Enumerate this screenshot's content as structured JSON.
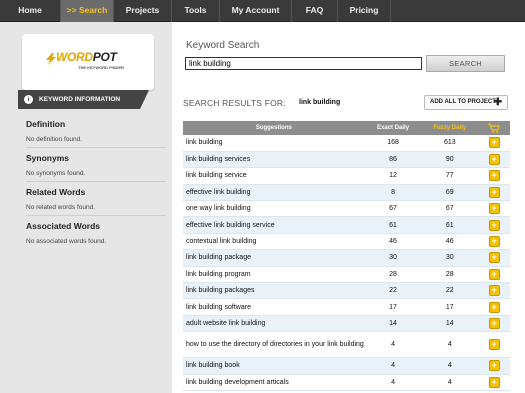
{
  "nav": {
    "items": [
      {
        "label": "Home",
        "active": false
      },
      {
        "label": ">> Search",
        "active": true
      },
      {
        "label": "Projects",
        "active": false
      },
      {
        "label": "Tools",
        "active": false
      },
      {
        "label": "My Account",
        "active": false
      },
      {
        "label": "FAQ",
        "active": false
      },
      {
        "label": "Pricing",
        "active": false
      }
    ]
  },
  "logo": {
    "part1": "WORD",
    "part2": "POT",
    "subtitle": "THE KEYWORD FINDER"
  },
  "keyword_info": {
    "header": "KEYWORD INFORMATION",
    "sections": [
      {
        "title": "Definition",
        "value": "No definition found."
      },
      {
        "title": "Synonyms",
        "value": "No synonyms found."
      },
      {
        "title": "Related Words",
        "value": "No related words found."
      },
      {
        "title": "Associated Words",
        "value": "No associated words found."
      }
    ]
  },
  "search": {
    "label": "Keyword Search",
    "value": "link building",
    "button_label": "SEARCH"
  },
  "results": {
    "label": "SEARCH RESULTS FOR:",
    "term": "link building",
    "add_all_label": "ADD ALL TO PROJECT",
    "columns": [
      "Suggestions",
      "Exact Daily",
      "Fuzzy Daily"
    ],
    "rows": [
      {
        "keyword": "link building",
        "exact": "168",
        "fuzzy": "613"
      },
      {
        "keyword": "link building services",
        "exact": "86",
        "fuzzy": "90"
      },
      {
        "keyword": "link building service",
        "exact": "12",
        "fuzzy": "77"
      },
      {
        "keyword": "effective link building",
        "exact": "8",
        "fuzzy": "69"
      },
      {
        "keyword": "one way link building",
        "exact": "67",
        "fuzzy": "67"
      },
      {
        "keyword": "effective link building service",
        "exact": "61",
        "fuzzy": "61"
      },
      {
        "keyword": "contextual link building",
        "exact": "46",
        "fuzzy": "46"
      },
      {
        "keyword": "link building package",
        "exact": "30",
        "fuzzy": "30"
      },
      {
        "keyword": "link building program",
        "exact": "28",
        "fuzzy": "28"
      },
      {
        "keyword": "link building packages",
        "exact": "22",
        "fuzzy": "22"
      },
      {
        "keyword": "link building software",
        "exact": "17",
        "fuzzy": "17"
      },
      {
        "keyword": "adult website link building",
        "exact": "14",
        "fuzzy": "14"
      },
      {
        "keyword": "how to use the directory of directories in your link building",
        "exact": "4",
        "fuzzy": "4"
      },
      {
        "keyword": "link building book",
        "exact": "4",
        "fuzzy": "4"
      },
      {
        "keyword": "link building development articals",
        "exact": "4",
        "fuzzy": "4"
      }
    ]
  },
  "colors": {
    "nav_bg": "#3a3a3a",
    "nav_active": "#f7c21b",
    "accent": "#f5c000",
    "row_alt": "#e9f2f9"
  }
}
